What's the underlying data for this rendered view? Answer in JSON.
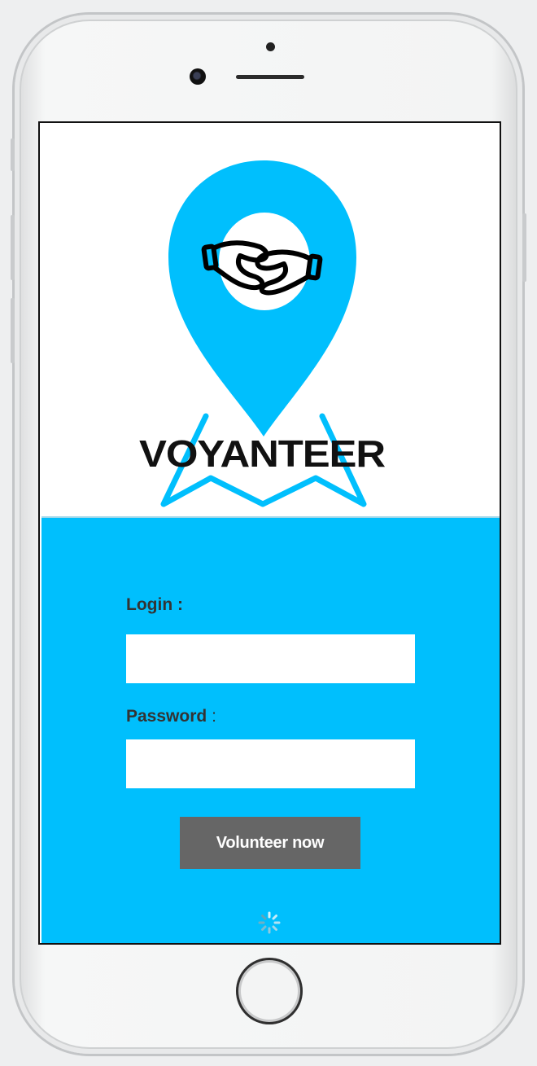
{
  "app": {
    "brand_name": "VOYANTEER",
    "accent_color": "#00bffd"
  },
  "form": {
    "login_label": "Login",
    "password_label": "Password",
    "label_separator": ":",
    "login_value": "",
    "password_value": "",
    "submit_label": "Volunteer now"
  },
  "icons": {
    "logo": "location-pin-handshake-icon",
    "map": "folded-map-icon",
    "spinner": "loading-spinner-icon"
  }
}
